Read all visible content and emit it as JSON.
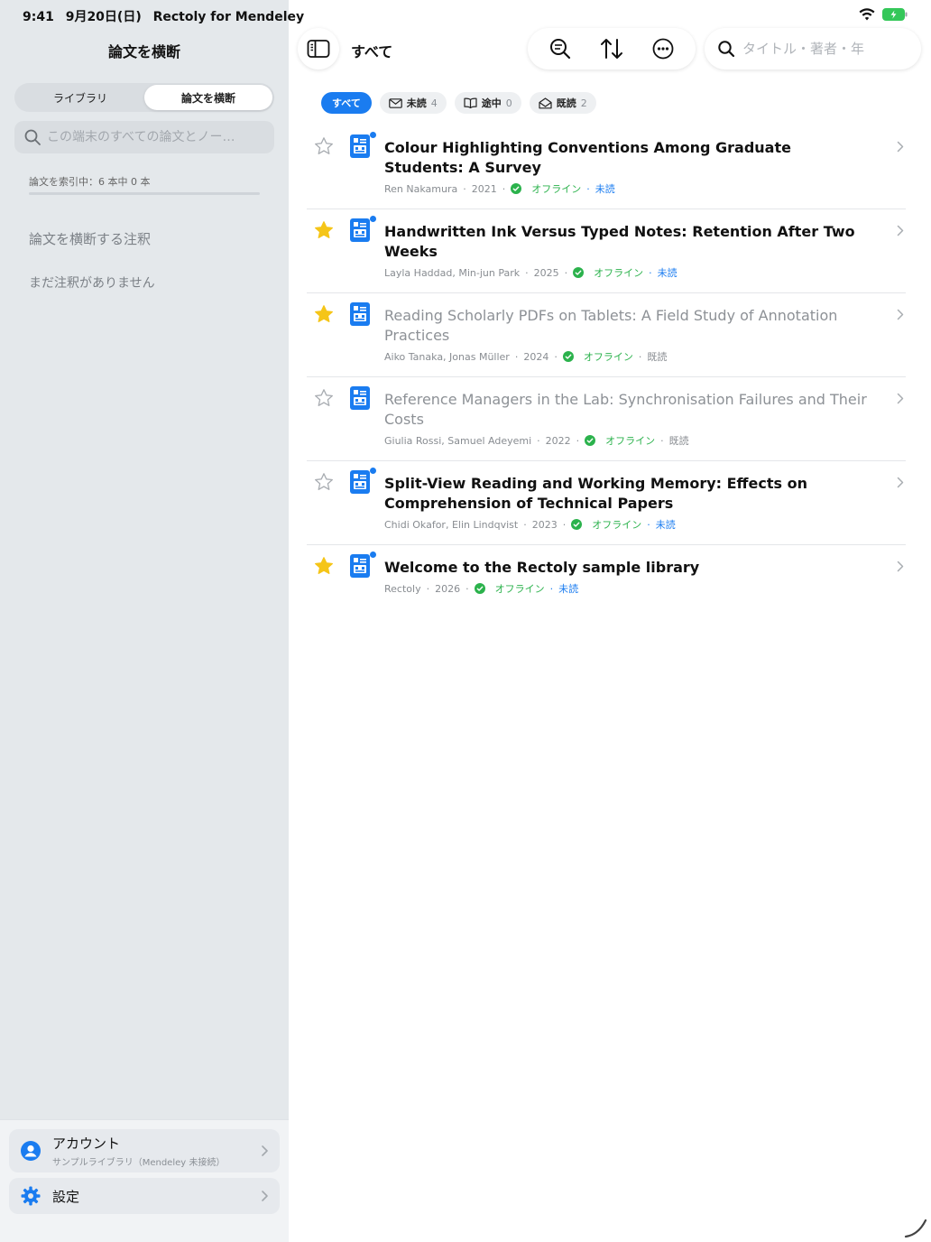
{
  "status_bar": {
    "time": "9:41",
    "date": "9月20日(日)",
    "app_name": "Rectoly for Mendeley"
  },
  "sidebar": {
    "title": "論文を横断",
    "segments": [
      "ライブラリ",
      "論文を横断"
    ],
    "active_segment": 1,
    "search_placeholder": "この端末のすべての論文とノー…",
    "index_status": "論文を索引中：6 本中 0 本",
    "index_progress": 0,
    "cross_heading": "論文を横断する注釈",
    "no_annotations": "まだ注釈がありません",
    "account": {
      "title": "アカウント",
      "subtitle": "サンプルライブラリ（Mendeley 未接続）"
    },
    "settings": {
      "title": "設定"
    }
  },
  "main": {
    "title": "すべて",
    "search_placeholder": "タイトル・著者・年",
    "icons": [
      "sidebar-toggle-icon",
      "zoom-search-icon",
      "sort-icon",
      "more-icon",
      "search-icon"
    ],
    "filters": [
      {
        "label": "すべて",
        "count": "",
        "icon": ""
      },
      {
        "label": "未読",
        "count": "4",
        "icon": "envelope-icon"
      },
      {
        "label": "途中",
        "count": "0",
        "icon": "book-icon"
      },
      {
        "label": "既読",
        "count": "2",
        "icon": "open-envelope-icon"
      }
    ],
    "papers": [
      {
        "title": "Colour Highlighting Conventions Among Graduate Students: A Survey",
        "authors": "Ren Nakamura",
        "year": "2021",
        "offline": "オフライン",
        "status": "未読",
        "starred": false,
        "unread": true
      },
      {
        "title": "Handwritten Ink Versus Typed Notes: Retention After Two Weeks",
        "authors": "Layla Haddad, Min-jun Park",
        "year": "2025",
        "offline": "オフライン",
        "status": "未読",
        "starred": true,
        "unread": true
      },
      {
        "title": "Reading Scholarly PDFs on Tablets: A Field Study of Annotation Practices",
        "authors": "Aiko Tanaka, Jonas Müller",
        "year": "2024",
        "offline": "オフライン",
        "status": "既読",
        "starred": true,
        "unread": false
      },
      {
        "title": "Reference Managers in the Lab: Synchronisation Failures and Their Costs",
        "authors": "Giulia Rossi, Samuel Adeyemi",
        "year": "2022",
        "offline": "オフライン",
        "status": "既読",
        "starred": false,
        "unread": false
      },
      {
        "title": "Split-View Reading and Working Memory: Effects on Comprehension of Technical Papers",
        "authors": "Chidi Okafor, Elin Lindqvist",
        "year": "2023",
        "offline": "オフライン",
        "status": "未読",
        "starred": false,
        "unread": true
      },
      {
        "title": "Welcome to the Rectoly sample library",
        "authors": "Rectoly",
        "year": "2026",
        "offline": "オフライン",
        "status": "未読",
        "starred": true,
        "unread": true
      }
    ]
  },
  "colors": {
    "accent": "#1a7cf0",
    "offline": "#2bb24c",
    "star": "#f5c518",
    "sidebar_bg": "#e4e8eb"
  }
}
